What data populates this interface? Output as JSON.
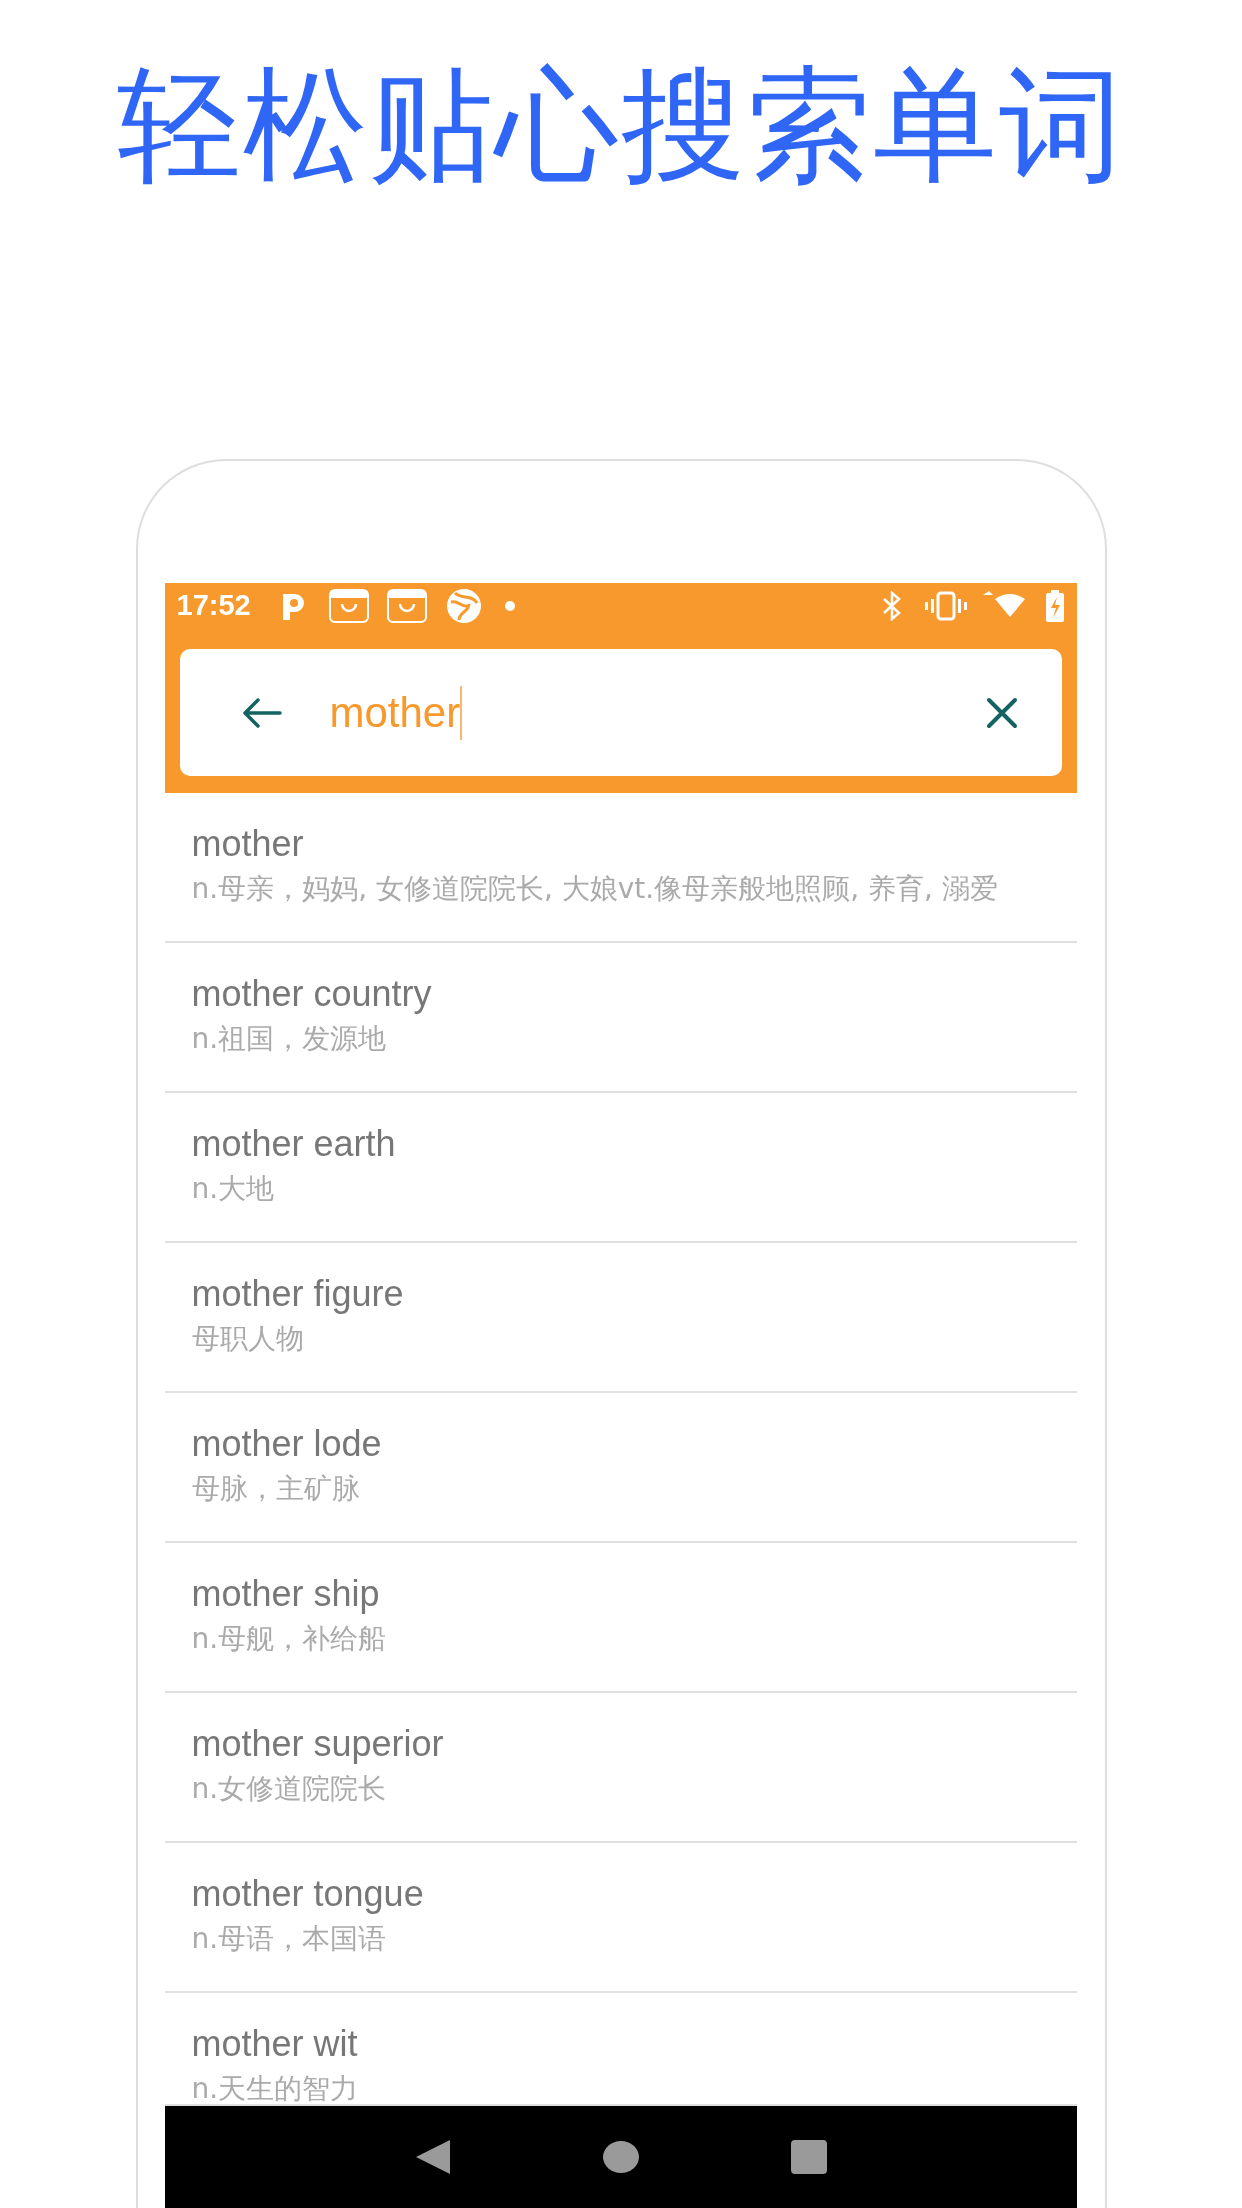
{
  "headline": "轻松贴心搜索单词",
  "status_bar": {
    "time": "17:52"
  },
  "search": {
    "value": "mother"
  },
  "results": [
    {
      "word": "mother",
      "definition": "n.母亲，妈妈, 女修道院院长, 大娘vt.像母亲般地照顾, 养育, 溺爱"
    },
    {
      "word": "mother country",
      "definition": "n.祖国，发源地"
    },
    {
      "word": "mother earth",
      "definition": "n.大地"
    },
    {
      "word": "mother figure",
      "definition": "母职人物"
    },
    {
      "word": "mother lode",
      "definition": "母脉，主矿脉"
    },
    {
      "word": "mother ship",
      "definition": "n.母舰，补给船"
    },
    {
      "word": "mother superior",
      "definition": "n.女修道院院长"
    },
    {
      "word": "mother tongue",
      "definition": "n.母语，本国语"
    },
    {
      "word": "mother wit",
      "definition": "n.天生的智力"
    }
  ]
}
